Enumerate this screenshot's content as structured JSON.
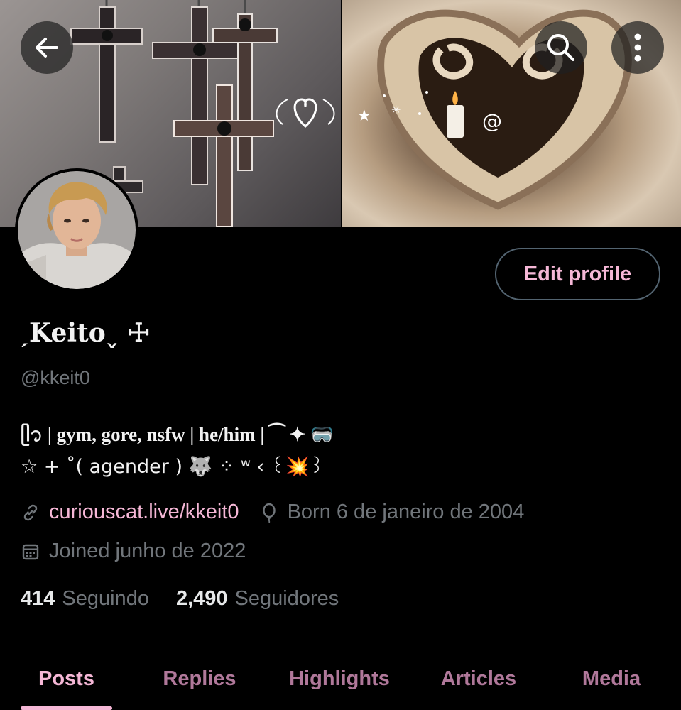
{
  "header": {
    "back_icon": "arrow-left-icon",
    "search_icon": "search-icon",
    "more_icon": "more-vertical-icon"
  },
  "profile": {
    "display_name": "ˏKeito˯ ☩",
    "handle": "@kkeit0",
    "bio": {
      "line1": "ᥫ᭡ | gym, gore, nsfw | he/him | ⁀ ✦ 🥽",
      "line2": "☆ + ˚( agender ) 🐺 ⁘ ʷ ‹ ꒰💥꒱"
    },
    "website": "curiouscat.live/kkeit0",
    "born": "Born 6 de janeiro de 2004",
    "joined": "Joined junho de 2022",
    "following_count": "414",
    "following_label": "Seguindo",
    "followers_count": "2,490",
    "followers_label": "Seguidores",
    "edit_button": "Edit profile"
  },
  "tabs": [
    {
      "label": "Posts",
      "active": true
    },
    {
      "label": "Replies",
      "active": false
    },
    {
      "label": "Highlights",
      "active": false
    },
    {
      "label": "Articles",
      "active": false
    },
    {
      "label": "Media",
      "active": false
    }
  ],
  "colors": {
    "accent": "#f5b7d6",
    "tab_inactive": "#b0789a",
    "muted": "#71767b",
    "background": "#000000",
    "button_border": "#536471"
  }
}
